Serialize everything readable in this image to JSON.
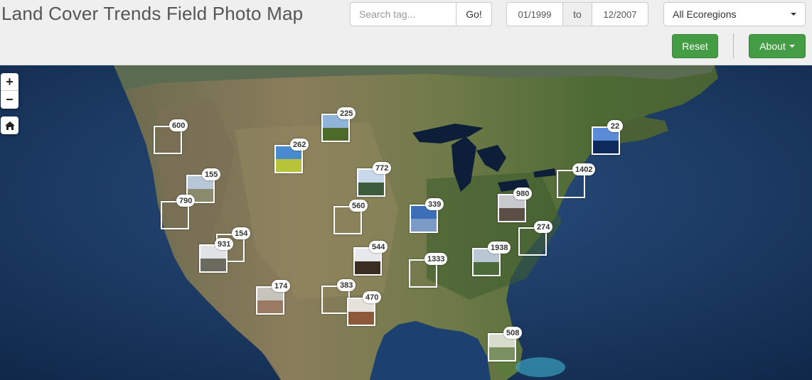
{
  "header": {
    "title": "Land Cover Trends Field Photo Map",
    "search": {
      "placeholder": "Search tag...",
      "value": "",
      "go_label": "Go!"
    },
    "date_range": {
      "start": "01/1999",
      "separator": "to",
      "end": "12/2007"
    },
    "ecoregion_select": {
      "selected": "All Ecoregions"
    },
    "reset_label": "Reset",
    "about_label": "About"
  },
  "map": {
    "zoom_in_label": "+",
    "zoom_out_label": "−",
    "home_icon": "home-icon",
    "clusters": [
      {
        "count": "600",
        "photo": false
      },
      {
        "count": "225",
        "photo": true,
        "sky": "#8fb3d9",
        "ground": "#4c6b2a"
      },
      {
        "count": "262",
        "photo": true,
        "sky": "#4a8bd0",
        "ground": "#b7c43a"
      },
      {
        "count": "155",
        "photo": true,
        "sky": "#b8c7d8",
        "ground": "#8a8a6c"
      },
      {
        "count": "790",
        "photo": false
      },
      {
        "count": "772",
        "photo": true,
        "sky": "#c9d8ea",
        "ground": "#3d5c3b"
      },
      {
        "count": "560",
        "photo": false
      },
      {
        "count": "339",
        "photo": true,
        "sky": "#3c6fb8",
        "ground": "#7c9bc6"
      },
      {
        "count": "154",
        "photo": false
      },
      {
        "count": "931",
        "photo": true,
        "sky": "#dfe3e6",
        "ground": "#6b6a5e"
      },
      {
        "count": "544",
        "photo": true,
        "sky": "#e6e8ec",
        "ground": "#3a2e22"
      },
      {
        "count": "1333",
        "photo": false
      },
      {
        "count": "1938",
        "photo": true,
        "sky": "#b9c6d4",
        "ground": "#4d6b3a"
      },
      {
        "count": "980",
        "photo": true,
        "sky": "#c8c9cc",
        "ground": "#5a4e45"
      },
      {
        "count": "274",
        "photo": false
      },
      {
        "count": "1402",
        "photo": false
      },
      {
        "count": "22",
        "photo": true,
        "sky": "#5b8bd6",
        "ground": "#0e2a5c"
      },
      {
        "count": "174",
        "photo": true,
        "sky": "#c7c4bd",
        "ground": "#9a7a62"
      },
      {
        "count": "383",
        "photo": false
      },
      {
        "count": "470",
        "photo": true,
        "sky": "#e5e2dc",
        "ground": "#8c5a3a"
      },
      {
        "count": "508",
        "photo": true,
        "sky": "#d7dccc",
        "ground": "#7a9060"
      }
    ]
  }
}
